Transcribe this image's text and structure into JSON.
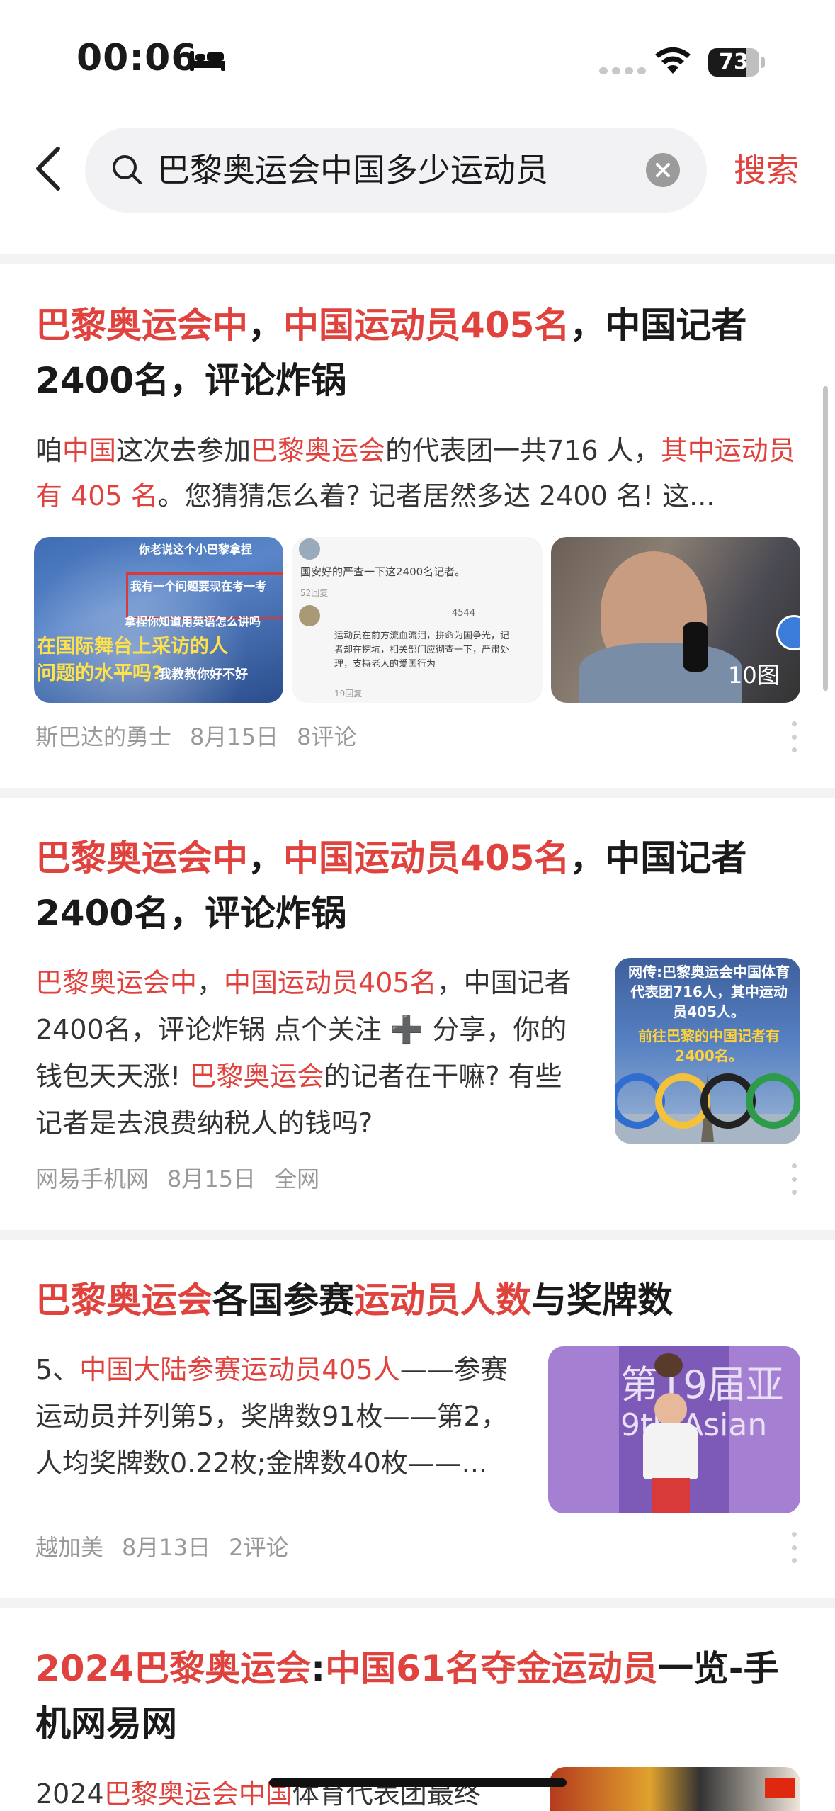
{
  "status_bar": {
    "time": "00:06",
    "battery_percent": "73",
    "battery_level": 0.73
  },
  "search": {
    "query": "巴黎奥运会中国多少运动员",
    "submit_label": "搜索"
  },
  "results": [
    {
      "title": [
        {
          "t": "巴黎奥运会中",
          "hl": true
        },
        {
          "t": "，",
          "hl": false
        },
        {
          "t": "中国运动员405名",
          "hl": true
        },
        {
          "t": "，中国记者2400名，评论炸锅",
          "hl": false
        }
      ],
      "snippet": [
        {
          "t": "咱",
          "hl": false
        },
        {
          "t": "中国",
          "hl": true
        },
        {
          "t": "这次去参加",
          "hl": false
        },
        {
          "t": "巴黎奥运会",
          "hl": true
        },
        {
          "t": "的代表团一共716 人，",
          "hl": false
        },
        {
          "t": "其中运动员有 405 名",
          "hl": true
        },
        {
          "t": "。您猜猜怎么着? 记者居然多达 2400 名! 这...",
          "hl": false
        }
      ],
      "images": [
        {
          "lines": [
            "你老说这个小巴黎拿捏",
            "我有一个问题要现在考一考",
            "拿捏你知道用英语怎么讲吗",
            "在国际舞台上采访的人",
            "问题的水平吗?",
            "我教教你好不好"
          ]
        },
        {
          "lines": [
            "国安好的严查一下这2400名记者。",
            "52回复",
            "4544",
            "运动员在前方流血流泪，拼命为国争光，记者却在挖坑，相关部门应彻查一下，严肃处理，支持老人的爱国行为",
            "19回复"
          ]
        },
        {
          "lines": [
            "10图"
          ]
        }
      ],
      "source": "斯巴达的勇士",
      "date": "8月15日",
      "extra": "8评论"
    },
    {
      "title": [
        {
          "t": "巴黎奥运会中",
          "hl": true
        },
        {
          "t": "，",
          "hl": false
        },
        {
          "t": "中国运动员405名",
          "hl": true
        },
        {
          "t": "，中国记者2400名，评论炸锅",
          "hl": false
        }
      ],
      "snippet": [
        {
          "t": "巴黎奥运会中",
          "hl": true
        },
        {
          "t": "，",
          "hl": false
        },
        {
          "t": "中国运动员405名",
          "hl": true
        },
        {
          "t": "，中国记者2400名，评论炸锅 点个关注 ➕ 分享，你的钱包天天涨! ",
          "hl": false
        },
        {
          "t": "巴黎奥运会",
          "hl": true
        },
        {
          "t": "的记者在干嘛? 有些记者是去浪费纳税人的钱吗?",
          "hl": false
        }
      ],
      "thumb_text": [
        "网传:巴黎奥运会中国体育代表团716人，其中运动员405人。",
        "前往巴黎的中国记者有2400名。"
      ],
      "source": "网易手机网",
      "date": "8月15日",
      "extra": "全网"
    },
    {
      "title": [
        {
          "t": "巴黎奥运会",
          "hl": true
        },
        {
          "t": "各国参赛",
          "hl": false
        },
        {
          "t": "运动员人数",
          "hl": true
        },
        {
          "t": "与奖牌数",
          "hl": false
        }
      ],
      "snippet": [
        {
          "t": "5、",
          "hl": false
        },
        {
          "t": "中国大陆参赛运动员405人",
          "hl": true
        },
        {
          "t": "——参赛运动员并列第5，奖牌数91枚——第2，人均奖牌数0.22枚;金牌数40枚——...",
          "hl": false
        }
      ],
      "thumb_text": [
        "第19届亚",
        "9th Asian"
      ],
      "source": "越加美",
      "date": "8月13日",
      "extra": "2评论"
    },
    {
      "title": [
        {
          "t": "2024巴黎奥运会",
          "hl": true
        },
        {
          "t": ":",
          "hl": false
        },
        {
          "t": "中国61名夺金运动员",
          "hl": true
        },
        {
          "t": "一览-手机网易网",
          "hl": false
        }
      ],
      "snippet": [
        {
          "t": "2024",
          "hl": false
        },
        {
          "t": "巴黎奥运会中国",
          "hl": true
        },
        {
          "t": "体育代表团最终",
          "hl": false
        }
      ]
    }
  ]
}
